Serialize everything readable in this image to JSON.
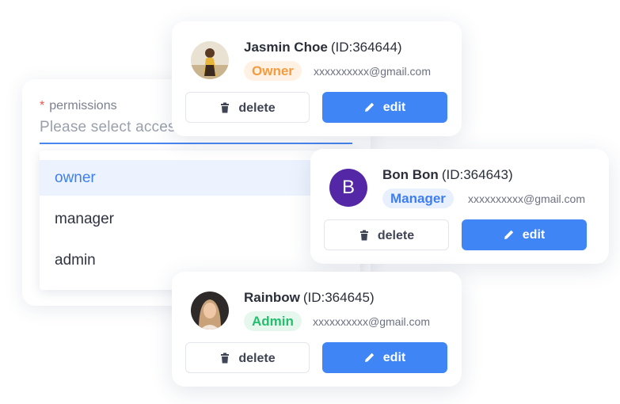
{
  "permissions": {
    "required_mark": "*",
    "label": "permissions",
    "placeholder": "Please select access rights",
    "options": [
      "owner",
      "manager",
      "admin"
    ],
    "selected": "owner"
  },
  "users": [
    {
      "name": "Jasmin Choe",
      "id": "(ID:364644)",
      "role": "Owner",
      "email": "xxxxxxxxxx@gmail.com",
      "delete_label": "delete",
      "edit_label": "edit"
    },
    {
      "name": "Bon Bon",
      "id": "(ID:364643)",
      "avatar_letter": "B",
      "role": "Manager",
      "email": "xxxxxxxxxx@gmail.com",
      "delete_label": "delete",
      "edit_label": "edit"
    },
    {
      "name": "Rainbow",
      "id": "(ID:364645)",
      "role": "Admin",
      "email": "xxxxxxxxxx@gmail.com",
      "delete_label": "delete",
      "edit_label": "edit"
    }
  ],
  "colors": {
    "accent": "#3f85f5",
    "owner": "#f59b3d",
    "manager": "#3d7ef1",
    "admin": "#22c06e",
    "avatar_b": "#5327a6"
  },
  "icons": {
    "delete": "trash-icon",
    "edit": "pencil-icon"
  }
}
